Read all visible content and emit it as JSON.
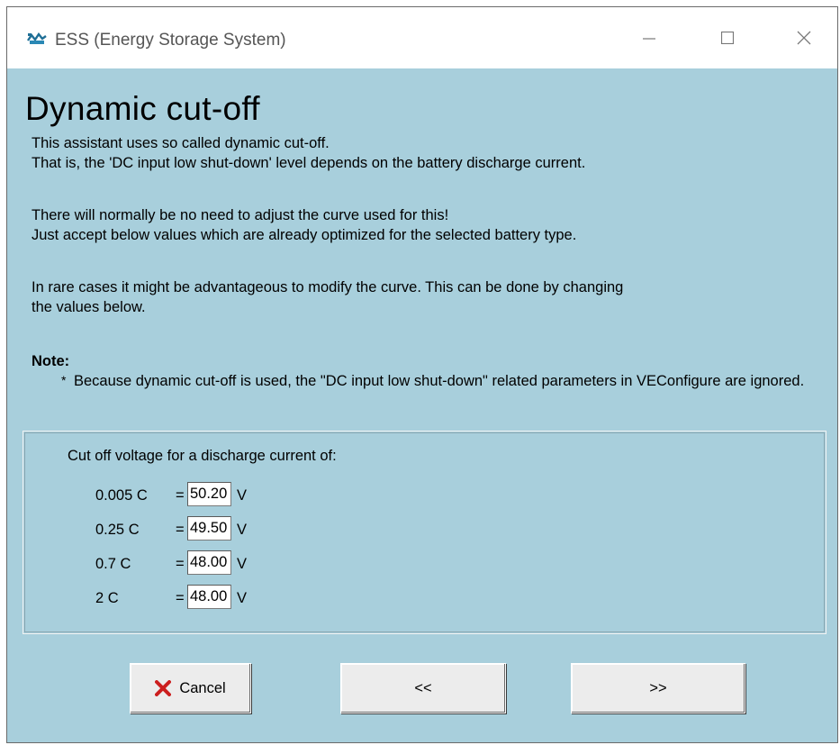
{
  "window": {
    "title": "ESS (Energy Storage System)",
    "icon": "ess-app-icon",
    "controls": [
      "minimize",
      "maximize",
      "close"
    ]
  },
  "page": {
    "heading": "Dynamic cut-off",
    "para1": "This assistant uses so called dynamic cut-off.\nThat is, the  'DC input low shut-down' level depends on the battery discharge current.",
    "para2": "There will normally be no need to adjust the curve used for this!\nJust accept below values which are already optimized for the selected battery type.",
    "para3": "In rare cases it might be advantageous to modify the curve. This can be done by changing\nthe values below.",
    "note_label": "Note:",
    "note_bullet": "*",
    "note_text": "Because dynamic cut-off is used, the \"DC input low shut-down\" related parameters in VEConfigure are ignored."
  },
  "cutoff": {
    "title": "Cut off voltage for a discharge current of:",
    "rows": [
      {
        "label": "0.005 C",
        "eq": "=",
        "value": "50.20",
        "unit": "V"
      },
      {
        "label": "0.25 C",
        "eq": "=",
        "value": "49.50",
        "unit": "V"
      },
      {
        "label": "0.7 C",
        "eq": "=",
        "value": "48.00",
        "unit": "V"
      },
      {
        "label": "2 C",
        "eq": "=",
        "value": "48.00",
        "unit": "V"
      }
    ]
  },
  "buttons": {
    "cancel": "Cancel",
    "back": "<<",
    "next": ">>"
  },
  "colors": {
    "background": "#a8cfdc",
    "cancel_icon": "#cc1f1f"
  }
}
